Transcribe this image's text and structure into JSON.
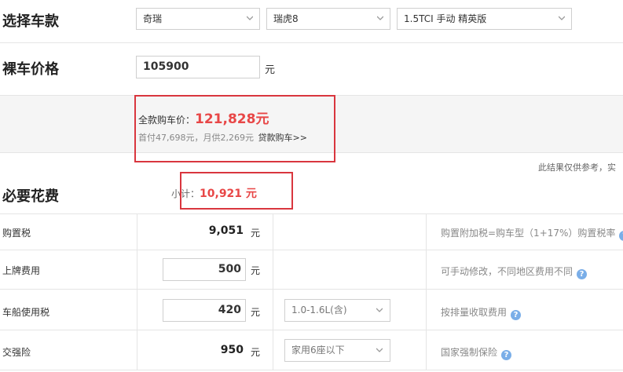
{
  "select_car": {
    "title": "选择车款",
    "brand": "奇瑞",
    "series": "瑞虎8",
    "model": "1.5TCI 手动 精英版"
  },
  "bare_price": {
    "title": "裸车价格",
    "value": "105900",
    "unit": "元"
  },
  "summary": {
    "total_label": "全款购车价：",
    "total_value": "121,828元",
    "down_payment_text": "首付47,698元，月供2,269元",
    "loan_link": "贷款购车>>",
    "disclaimer": "此结果仅供参考，实"
  },
  "necessary": {
    "title": "必要花费",
    "subtotal_label": "小计：",
    "subtotal_value": "10,921 元"
  },
  "rows": [
    {
      "label": "购置税",
      "value": "9,051",
      "unit": "元",
      "note": "购置附加税=购车型（1+17%）购置税率"
    },
    {
      "label": "上牌费用",
      "value": "500",
      "unit": "元",
      "note": "可手动修改，不同地区费用不同"
    },
    {
      "label": "车船使用税",
      "value": "420",
      "unit": "元",
      "option": "1.0-1.6L(含)",
      "note": "按排量收取费用"
    },
    {
      "label": "交强险",
      "value": "950",
      "unit": "元",
      "option": "家用6座以下",
      "note": "国家强制保险"
    }
  ],
  "icons": {
    "help": "?",
    "chevron": "chevron-down-icon"
  },
  "colors": {
    "price_red": "#e84747",
    "highlight_box": "#d9363e",
    "help_icon": "#7aaee8",
    "summary_bg": "#f5f5f5"
  }
}
